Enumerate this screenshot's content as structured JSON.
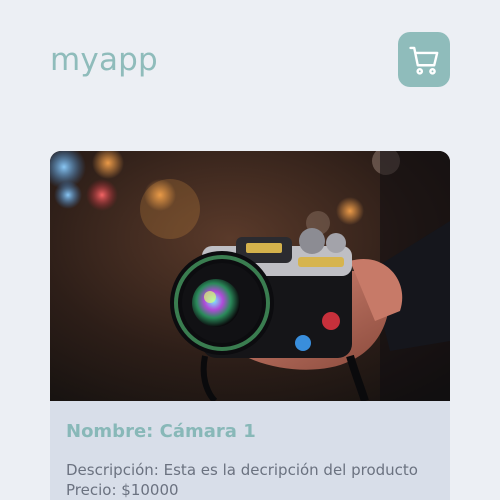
{
  "header": {
    "brand": "myapp",
    "cart_icon": "shopping-cart-icon"
  },
  "product": {
    "name_label": "Nombre:",
    "name": "Cámara 1",
    "description_label": "Descripción:",
    "description": "Esta es la decripción del producto",
    "price_label": "Precio:",
    "price": "$10000",
    "image_icon": "camera-photo"
  },
  "colors": {
    "background": "#eceff4",
    "accent": "#8fbcbb",
    "card": "#d8dee9",
    "text_muted": "#6b7280"
  }
}
